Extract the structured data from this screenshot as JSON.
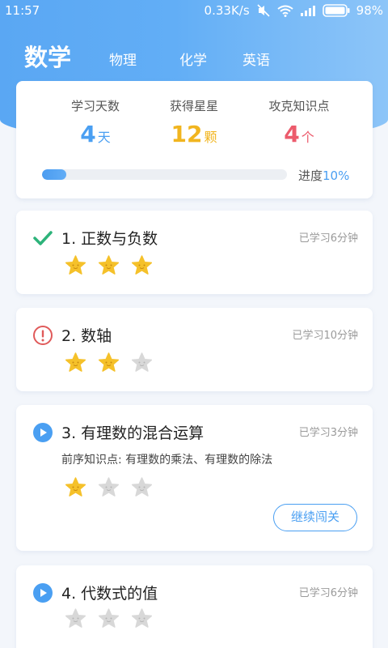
{
  "status_bar": {
    "time": "11:57",
    "speed": "0.33K/s",
    "battery": "98%"
  },
  "tabs": [
    {
      "label": "数学",
      "active": true
    },
    {
      "label": "物理",
      "active": false
    },
    {
      "label": "化学",
      "active": false
    },
    {
      "label": "英语",
      "active": false
    }
  ],
  "summary": {
    "study_days": {
      "label": "学习天数",
      "value": "4",
      "unit": "天"
    },
    "stars": {
      "label": "获得星星",
      "value": "12",
      "unit": "颗"
    },
    "points": {
      "label": "攻克知识点",
      "value": "4",
      "unit": "个"
    },
    "progress": {
      "label": "进度",
      "percent_text": "10%",
      "fraction": 0.1
    }
  },
  "lessons": [
    {
      "title": "1. 正数与负数",
      "time": "已学习6分钟",
      "status": "check-icon",
      "stars_earned": 3,
      "stars_total": 3
    },
    {
      "title": "2. 数轴",
      "time": "已学习10分钟",
      "status": "warning-icon",
      "stars_earned": 2,
      "stars_total": 3
    },
    {
      "title": "3. 有理数的混合运算",
      "time": "已学习3分钟",
      "status": "play-icon",
      "prereq": "前序知识点: 有理数的乘法、有理数的除法",
      "stars_earned": 1,
      "stars_total": 3,
      "button": "继续闯关"
    },
    {
      "title": "4. 代数式的值",
      "time": "已学习6分钟",
      "status": "play-icon",
      "stars_earned": 0,
      "stars_total": 3
    }
  ],
  "colors": {
    "accent": "#4a9ff2",
    "star_gold": "#f5c12a",
    "star_gray": "#d8d8d8",
    "red": "#ec5b6c",
    "green": "#2db37a"
  }
}
